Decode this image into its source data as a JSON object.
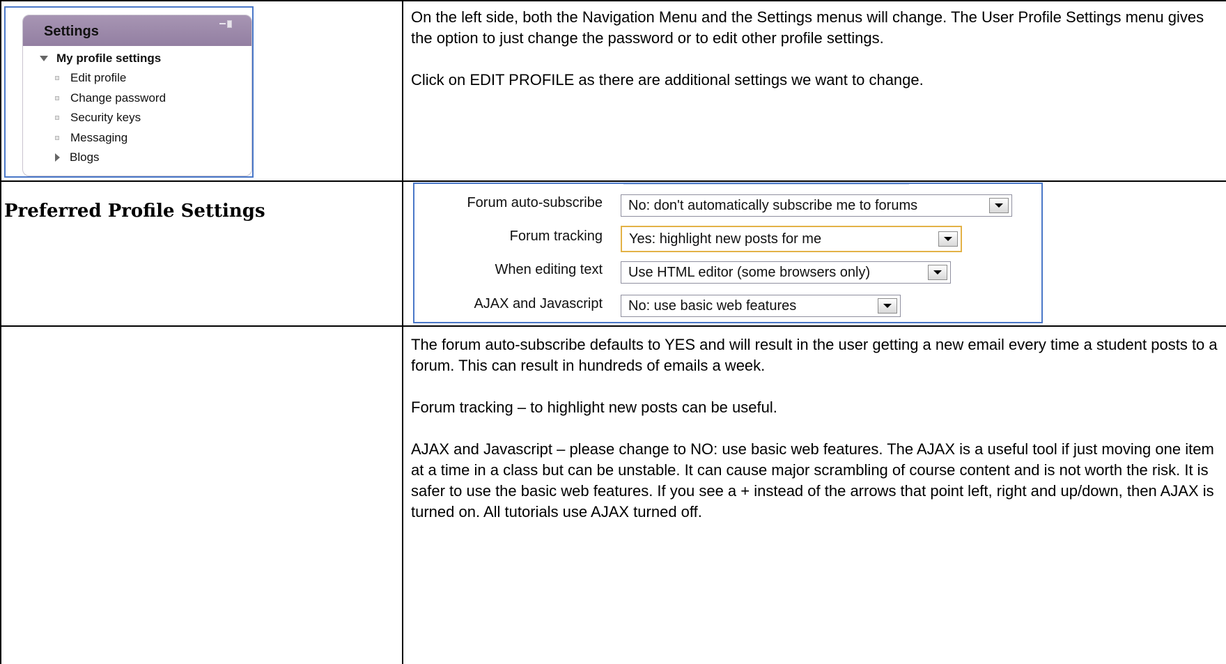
{
  "settings_block": {
    "title": "Settings",
    "parent": "My profile settings",
    "items": [
      {
        "label": "Edit profile",
        "icon": "bullet"
      },
      {
        "label": "Change password",
        "icon": "bullet"
      },
      {
        "label": "Security keys",
        "icon": "bullet"
      },
      {
        "label": "Messaging",
        "icon": "bullet"
      },
      {
        "label": "Blogs",
        "icon": "expand-arrow"
      }
    ]
  },
  "row1_text": {
    "p1": "On the left side, both the Navigation Menu and the Settings menus will change.  The User Profile Settings menu gives the option to just change the password or to edit other profile settings.",
    "p2": "Click on EDIT PROFILE as there are additional settings we want to change."
  },
  "heading": "Preferred Profile Settings",
  "profile_form": {
    "fields": [
      {
        "label": "Forum auto-subscribe",
        "value": "No: don't automatically subscribe me to forums"
      },
      {
        "label": "Forum tracking",
        "value": "Yes: highlight new posts for me"
      },
      {
        "label": "When editing text",
        "value": "Use HTML editor (some browsers only)"
      },
      {
        "label": "AJAX and Javascript",
        "value": "No: use basic web features"
      }
    ]
  },
  "row3_text": {
    "p1": "The forum auto-subscribe defaults to YES and will result in the user getting a new email every time a student posts to a forum.  This can result in hundreds of emails a week.",
    "p2": "Forum tracking – to highlight new posts can be useful.",
    "p3": "AJAX and Javascript – please change to NO: use basic web features.  The AJAX is a useful tool if just moving one item at a time in a class but can be unstable.  It can cause major scrambling of course content and is not worth the risk.  It is safer to use the basic web features.  If you see a + instead of the arrows that point left, right and up/down, then AJAX is turned on.  All tutorials use AJAX turned off."
  },
  "colors": {
    "block_header": "#9e8cab",
    "screenshot_border": "#4a78c8",
    "focus_border": "#e3b247"
  }
}
